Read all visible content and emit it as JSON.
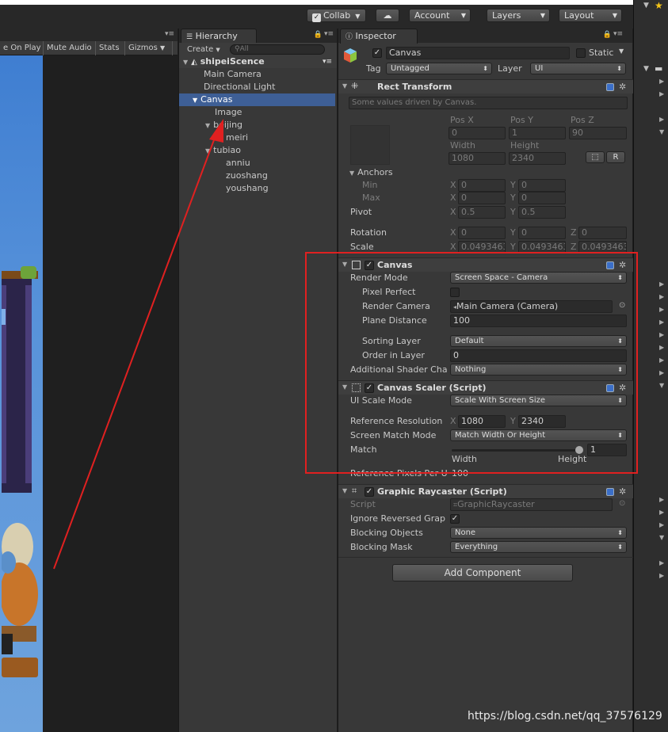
{
  "toolbar": {
    "collab": "Collab",
    "account": "Account",
    "layers": "Layers",
    "layout": "Layout"
  },
  "game_view": {
    "items": [
      "e On Play",
      "Mute Audio",
      "Stats",
      "Gizmos"
    ]
  },
  "hierarchy": {
    "tab": "Hierarchy",
    "create": "Create",
    "search_placeholder": "All",
    "scene": "shipeiScence",
    "items": {
      "main_camera": "Main Camera",
      "directional_light": "Directional Light",
      "canvas": "Canvas",
      "image": "Image",
      "beijing": "beijing",
      "meiri": "meiri",
      "tubiao": "tubiao",
      "anniu": "anniu",
      "zuoshang": "zuoshang",
      "youshang": "youshang"
    }
  },
  "inspector": {
    "tab": "Inspector",
    "object_name": "Canvas",
    "static": "Static",
    "tag_label": "Tag",
    "tag_value": "Untagged",
    "layer_label": "Layer",
    "layer_value": "UI",
    "rect_transform": {
      "title": "Rect Transform",
      "note": "Some values driven by Canvas.",
      "pos_x_label": "Pos X",
      "pos_y_label": "Pos Y",
      "pos_z_label": "Pos Z",
      "pos_x": "0",
      "pos_y": "1",
      "pos_z": "90",
      "width_label": "Width",
      "height_label": "Height",
      "width": "1080",
      "height": "2340",
      "r_button": "R",
      "anchors": "Anchors",
      "min": "Min",
      "max": "Max",
      "min_x": "0",
      "min_y": "0",
      "max_x": "0",
      "max_y": "0",
      "pivot": "Pivot",
      "pivot_x": "0.5",
      "pivot_y": "0.5",
      "rotation": "Rotation",
      "rot_x": "0",
      "rot_y": "0",
      "rot_z": "0",
      "scale": "Scale",
      "scale_x": "0.0493463",
      "scale_y": "0.0493463",
      "scale_z": "0.0493463"
    },
    "canvas": {
      "title": "Canvas",
      "render_mode_label": "Render Mode",
      "render_mode": "Screen Space - Camera",
      "pixel_perfect": "Pixel Perfect",
      "render_camera_label": "Render Camera",
      "render_camera": "Main Camera (Camera)",
      "plane_distance_label": "Plane Distance",
      "plane_distance": "100",
      "sorting_layer_label": "Sorting Layer",
      "sorting_layer": "Default",
      "order_label": "Order in Layer",
      "order": "0",
      "shader_label": "Additional Shader Cha",
      "shader": "Nothing"
    },
    "canvas_scaler": {
      "title": "Canvas Scaler (Script)",
      "ui_scale_label": "UI Scale Mode",
      "ui_scale": "Scale With Screen Size",
      "ref_res_label": "Reference Resolution",
      "ref_x": "1080",
      "ref_y": "2340",
      "match_mode_label": "Screen Match Mode",
      "match_mode": "Match Width Or Height",
      "match_label": "Match",
      "match_value": "1",
      "match_fraction": 1,
      "width": "Width",
      "height": "Height",
      "ref_pixels_label": "Reference Pixels Per U",
      "ref_pixels": "100"
    },
    "raycaster": {
      "title": "Graphic Raycaster (Script)",
      "script_label": "Script",
      "script": "GraphicRaycaster",
      "ignore_label": "Ignore Reversed Grap",
      "blocking_objects_label": "Blocking Objects",
      "blocking_objects": "None",
      "blocking_mask_label": "Blocking Mask",
      "blocking_mask": "Everything"
    },
    "add_component": "Add Component"
  },
  "watermark": "https://blog.csdn.net/qq_37576129",
  "colors": {
    "selection": "#3e5f96",
    "highlight_box": "#e02020",
    "arrow": "#e02020"
  }
}
